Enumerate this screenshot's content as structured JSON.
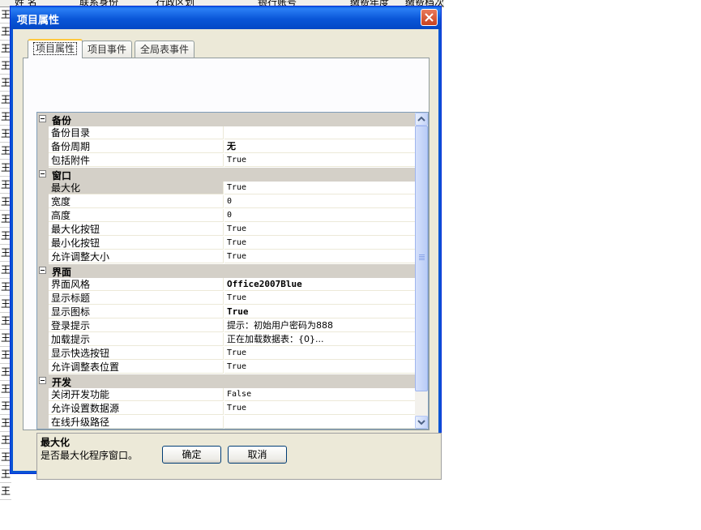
{
  "background_sheet": {
    "headers": [
      "姓  名",
      "联系身份",
      "行政区划",
      "银行账号",
      "缴费年度",
      "缴费档次"
    ],
    "row_first_char": [
      "王",
      "王",
      "王",
      "王",
      "王",
      "王",
      "王",
      "王",
      "王",
      "王",
      "王",
      "王",
      "王",
      "王",
      "王",
      "王",
      "王",
      "王",
      "王",
      "王",
      "王",
      "王",
      "王",
      "王",
      "王",
      "王",
      "王",
      "王",
      "王"
    ]
  },
  "dialog": {
    "title": "项目属性",
    "close_icon": "close-x",
    "tabs": [
      {
        "label": "项目属性",
        "active": true
      },
      {
        "label": "项目事件",
        "active": false
      },
      {
        "label": "全局表事件",
        "active": false
      }
    ],
    "categories": [
      {
        "label": "备份",
        "items": [
          {
            "name": "备份目录",
            "value": ""
          },
          {
            "name": "备份周期",
            "value": "无"
          },
          {
            "name": "包括附件",
            "value": "True"
          }
        ]
      },
      {
        "label": "窗口",
        "items": [
          {
            "name": "最大化",
            "value": "True"
          },
          {
            "name": "宽度",
            "value": "0"
          },
          {
            "name": "高度",
            "value": "0"
          },
          {
            "name": "最大化按钮",
            "value": "True"
          },
          {
            "name": "最小化按钮",
            "value": "True"
          },
          {
            "name": "允许调整大小",
            "value": "True"
          }
        ]
      },
      {
        "label": "界面",
        "items": [
          {
            "name": "界面风格",
            "value": "Office2007Blue"
          },
          {
            "name": "显示标题",
            "value": "True"
          },
          {
            "name": "显示图标",
            "value": "True"
          },
          {
            "name": "登录提示",
            "value": "提示：初始用户密码为888"
          },
          {
            "name": "加载提示",
            "value": "正在加载数据表：{0}..."
          },
          {
            "name": "显示快选按钮",
            "value": "True"
          },
          {
            "name": "允许调整表位置",
            "value": "True"
          }
        ]
      },
      {
        "label": "开发",
        "items": [
          {
            "name": "关闭开发功能",
            "value": "False"
          },
          {
            "name": "允许设置数据源",
            "value": "True"
          },
          {
            "name": "在线升级路径",
            "value": ""
          }
        ]
      }
    ],
    "selected_property": "最大化",
    "description": {
      "title": "最大化",
      "text": "是否最大化程序窗口。"
    },
    "ok_label": "确定",
    "cancel_label": "取消",
    "colors": {
      "titlebar": "#0a56d8",
      "face": "#ece9d8",
      "tab_highlight": "#ffc83c"
    }
  }
}
